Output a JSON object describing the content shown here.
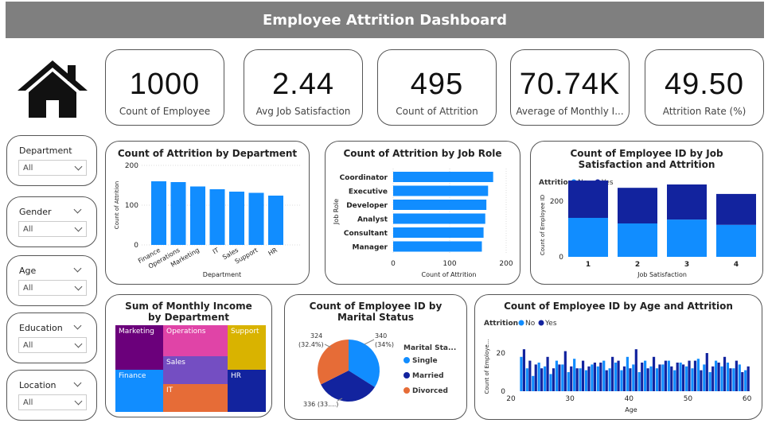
{
  "title": "Employee Attrition Dashboard",
  "icons": {
    "home": "home-icon"
  },
  "kpis": [
    {
      "value": "1000",
      "label": "Count of Employee"
    },
    {
      "value": "2.44",
      "label": "Avg Job Satisfaction"
    },
    {
      "value": "495",
      "label": "Count of Attrition"
    },
    {
      "value": "70.74K",
      "label": "Average of Monthly I..."
    },
    {
      "value": "49.50",
      "label": "Attrition Rate (%)"
    }
  ],
  "slicers": [
    {
      "label": "Department",
      "value": "All"
    },
    {
      "label": "Gender",
      "value": "All"
    },
    {
      "label": "Age",
      "value": "All"
    },
    {
      "label": "Education",
      "value": "All"
    },
    {
      "label": "Location",
      "value": "All"
    }
  ],
  "colors": {
    "blue": "#118DFF",
    "navy": "#12239E",
    "orange": "#E66C37",
    "purple": "#6B007B",
    "pink": "#E044A7",
    "violet": "#744EC2",
    "gold": "#D9B300",
    "banner": "#7f7f7f"
  },
  "chart_data": [
    {
      "id": "dept",
      "type": "bar",
      "title": "Count of Attrition by Department",
      "xlabel": "Department",
      "ylabel": "Count of Attrition",
      "categories": [
        "Finance",
        "Operations",
        "Marketing",
        "IT",
        "Sales",
        "Support",
        "HR"
      ],
      "values": [
        160,
        158,
        147,
        140,
        134,
        131,
        124
      ],
      "yticks": [
        "0",
        "100",
        "200"
      ],
      "ylim": [
        0,
        200
      ]
    },
    {
      "id": "role",
      "type": "bar",
      "orientation": "horizontal",
      "title": "Count of Attrition by Job Role",
      "xlabel": "Count of Attrition",
      "ylabel": "Job Role",
      "categories": [
        "Coordinator",
        "Executive",
        "Developer",
        "Analyst",
        "Consultant",
        "Manager"
      ],
      "values": [
        177,
        168,
        165,
        163,
        160,
        157
      ],
      "xticks": [
        "0",
        "100",
        "200"
      ],
      "xlim": [
        0,
        200
      ]
    },
    {
      "id": "jobsat",
      "type": "bar",
      "stacked": true,
      "title": "Count of Employee ID by Job Satisfaction and Attrition",
      "xlabel": "Job Satisfaction",
      "ylabel": "Count of Employee ID",
      "legend_title": "Attrition",
      "categories": [
        "1",
        "2",
        "3",
        "4"
      ],
      "series": [
        {
          "name": "No",
          "values": [
            140,
            120,
            134,
            115
          ]
        },
        {
          "name": "Yes",
          "values": [
            134,
            128,
            126,
            111
          ]
        }
      ],
      "yticks": [
        "0",
        "200"
      ],
      "ylim": [
        0,
        280
      ]
    },
    {
      "id": "income",
      "type": "treemap",
      "title": "Sum of Monthly Income by Department",
      "categories": [
        "Marketing",
        "Operations",
        "Support",
        "Finance",
        "Sales",
        "IT",
        "HR"
      ]
    },
    {
      "id": "marital",
      "type": "pie",
      "title": "Count of Employee ID by Marital Status",
      "legend_title": "Marital Sta...",
      "categories": [
        "Single",
        "Married",
        "Divorced"
      ],
      "values": [
        340,
        336,
        324
      ],
      "labels": [
        [
          "340",
          "(34%)"
        ],
        [
          "336 (33....)"
        ],
        [
          "324",
          "(32.4%)"
        ]
      ]
    },
    {
      "id": "age",
      "type": "bar",
      "title": "Count of Employee ID by Age and Attrition",
      "xlabel": "Age",
      "ylabel": "Count of Employe...",
      "legend_title": "Attrition",
      "x": [
        22,
        23,
        24,
        25,
        26,
        27,
        28,
        29,
        30,
        31,
        32,
        33,
        34,
        35,
        36,
        37,
        38,
        39,
        40,
        41,
        42,
        43,
        44,
        45,
        46,
        47,
        48,
        49,
        50,
        51,
        52,
        53,
        54,
        55,
        56,
        57,
        58,
        59,
        60
      ],
      "series": [
        {
          "name": "No",
          "values": [
            18,
            12,
            8,
            15,
            13,
            9,
            16,
            14,
            10,
            17,
            12,
            11,
            14,
            13,
            16,
            12,
            15,
            11,
            18,
            14,
            10,
            16,
            13,
            12,
            14,
            16,
            11,
            15,
            13,
            12,
            17,
            14,
            10,
            16,
            13,
            15,
            12,
            14,
            11
          ]
        },
        {
          "name": "Yes",
          "values": [
            22,
            16,
            14,
            12,
            18,
            12,
            14,
            21,
            13,
            12,
            16,
            13,
            15,
            15,
            11,
            18,
            16,
            13,
            12,
            22,
            15,
            12,
            18,
            14,
            16,
            13,
            15,
            14,
            16,
            16,
            11,
            20,
            13,
            15,
            18,
            12,
            16,
            10,
            13
          ]
        }
      ],
      "yticks": [
        "0",
        "20"
      ],
      "xticks": [
        "20",
        "30",
        "40",
        "50",
        "60"
      ],
      "ylim": [
        0,
        25
      ],
      "xlim": [
        20,
        61
      ]
    }
  ]
}
